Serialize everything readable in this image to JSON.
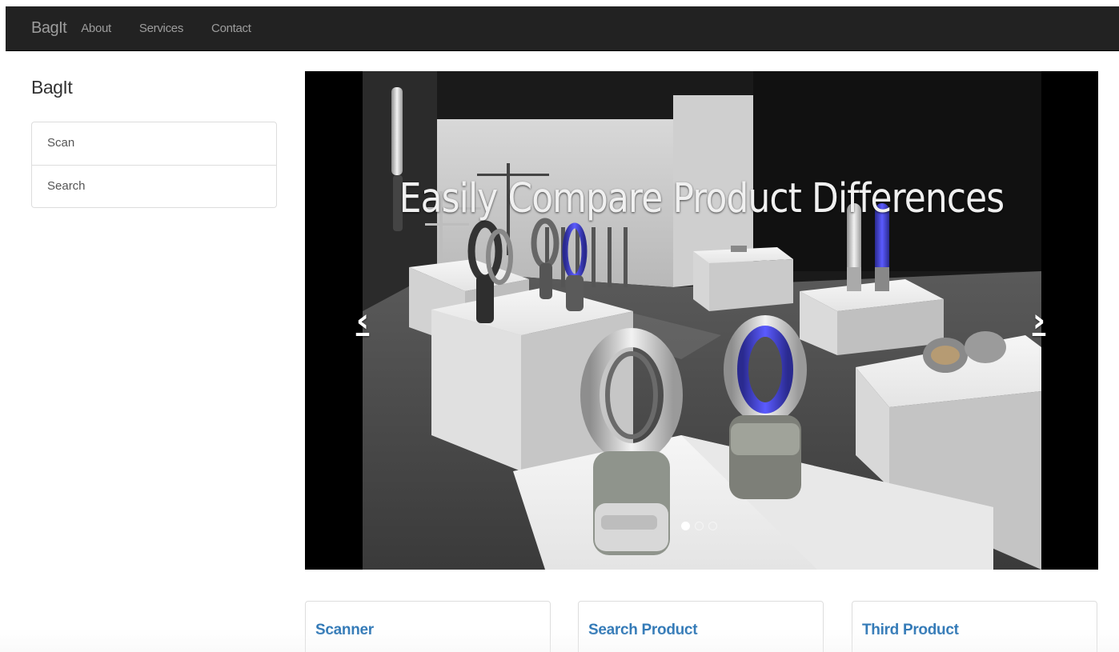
{
  "navbar": {
    "brand": "BagIt",
    "links": [
      "About",
      "Services",
      "Contact"
    ]
  },
  "sidebar": {
    "title": "BagIt",
    "items": [
      "Scan",
      "Search"
    ]
  },
  "carousel": {
    "caption": "Easily Compare Product Differences",
    "prev_icon": "chevron-left-icon",
    "next_icon": "chevron-right-icon",
    "slide_count": 3,
    "active_slide": 1
  },
  "panels": [
    "Scanner",
    "Search Product",
    "Third Product"
  ],
  "colors": {
    "navbar_bg": "#222222",
    "nav_text": "#9d9d9d",
    "link_blue": "#337ab7",
    "border": "#dddddd",
    "accent_purple": "#3b3bb5"
  }
}
